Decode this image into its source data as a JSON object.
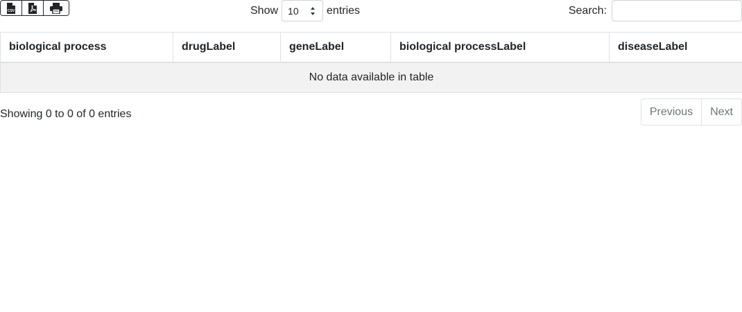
{
  "toolbar": {
    "export_buttons": [
      {
        "icon": "csv-file-icon",
        "label": "CSV"
      },
      {
        "icon": "pdf-file-icon"
      },
      {
        "icon": "print-icon"
      }
    ],
    "show_label": "Show",
    "page_length": "10",
    "entries_label": "entries",
    "search_label": "Search:",
    "search_value": ""
  },
  "table": {
    "columns": [
      "biological process",
      "drugLabel",
      "geneLabel",
      "biological processLabel",
      "diseaseLabel"
    ],
    "empty_message": "No data available in table"
  },
  "footer": {
    "info": "Showing 0 to 0 of 0 entries",
    "previous_label": "Previous",
    "next_label": "Next"
  }
}
